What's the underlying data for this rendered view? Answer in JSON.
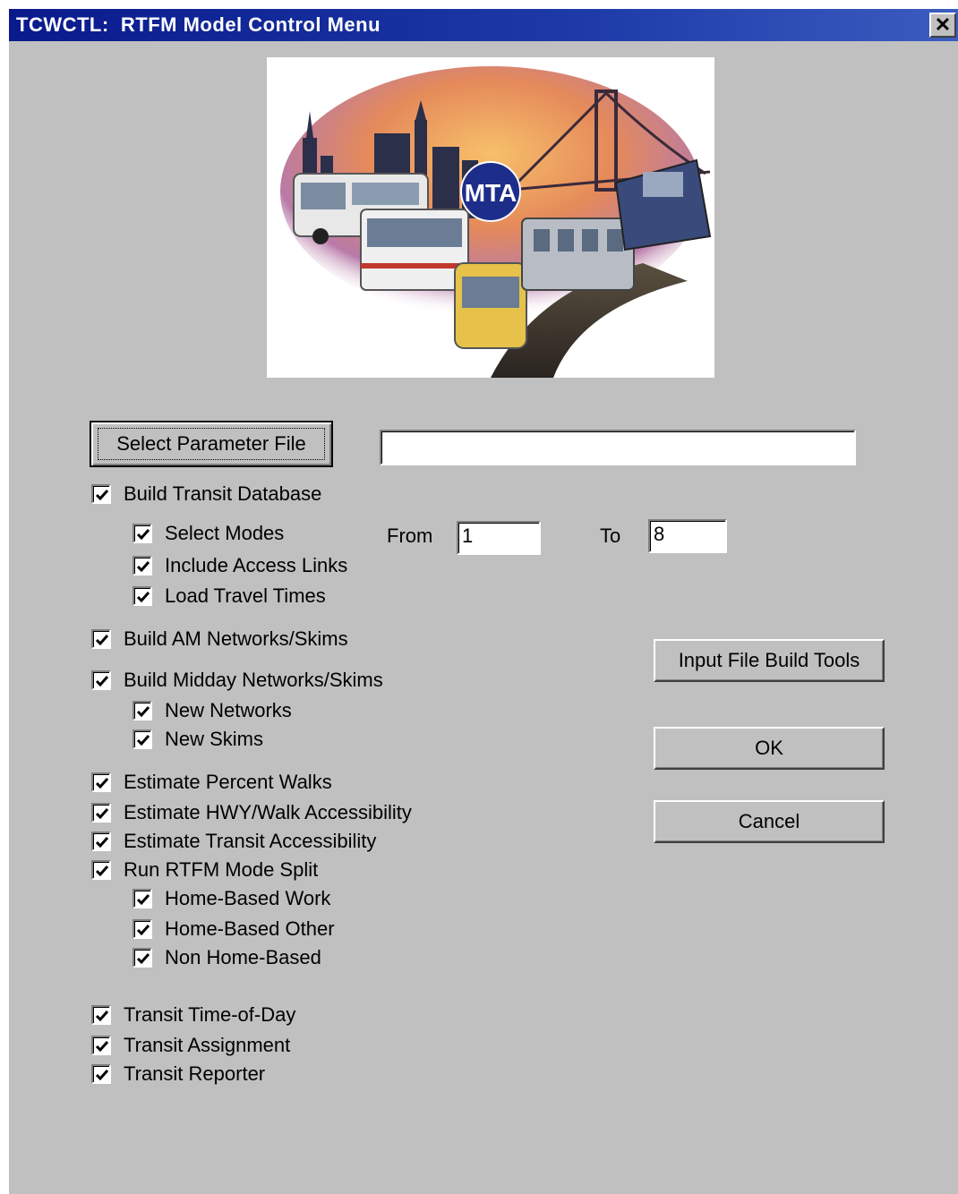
{
  "window": {
    "title": "TCWCTL:  RTFM Model Control Menu",
    "close_symbol": "✕"
  },
  "logo": {
    "badge": "MTA"
  },
  "param": {
    "select_button": "Select Parameter File",
    "file_path": ""
  },
  "options": [
    {
      "label": "Build Transit Database",
      "checked": true
    },
    {
      "label": "Select Modes",
      "checked": true
    },
    {
      "label": "Include Access Links",
      "checked": true
    },
    {
      "label": "Load Travel Times",
      "checked": true
    },
    {
      "label": "Build AM Networks/Skims",
      "checked": true
    },
    {
      "label": "Build Midday Networks/Skims",
      "checked": true
    },
    {
      "label": "New Networks",
      "checked": true
    },
    {
      "label": "New Skims",
      "checked": true
    },
    {
      "label": "Estimate Percent Walks",
      "checked": true
    },
    {
      "label": "Estimate HWY/Walk Accessibility",
      "checked": true
    },
    {
      "label": "Estimate Transit Accessibility",
      "checked": true
    },
    {
      "label": "Run RTFM Mode Split",
      "checked": true
    },
    {
      "label": "Home-Based Work",
      "checked": true
    },
    {
      "label": "Home-Based Other",
      "checked": true
    },
    {
      "label": "Non Home-Based",
      "checked": true
    },
    {
      "label": "Transit Time-of-Day",
      "checked": true
    },
    {
      "label": "Transit Assignment",
      "checked": true
    },
    {
      "label": "Transit Reporter",
      "checked": true
    }
  ],
  "modes": {
    "from_label": "From",
    "from_value": "1",
    "to_label": "To",
    "to_value": "8"
  },
  "buttons": {
    "input_tools": "Input File Build Tools",
    "ok": "OK",
    "cancel": "Cancel"
  }
}
